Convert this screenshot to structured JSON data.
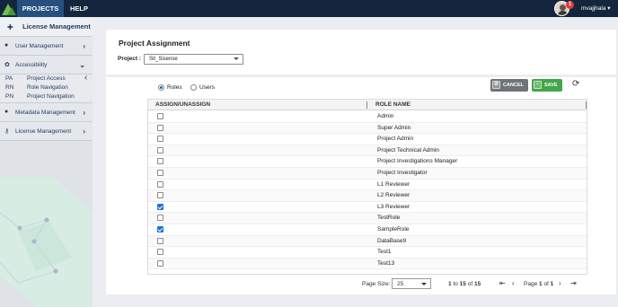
{
  "topbar": {
    "nav": [
      "PROJECTS",
      "HELP"
    ],
    "notification_count": "1",
    "username": "mvajjhala"
  },
  "sidebar": {
    "title": "License Management",
    "items": [
      {
        "label": "User Management"
      },
      {
        "label": "Accessibility"
      },
      {
        "label": "Metadata Management"
      },
      {
        "label": "License Management"
      }
    ],
    "subitems": [
      {
        "abbr": "PA",
        "label": "Project Access"
      },
      {
        "abbr": "RN",
        "label": "Role Navigation"
      },
      {
        "abbr": "PN",
        "label": "Project Navigation"
      }
    ]
  },
  "project_card": {
    "title": "Project Assignment",
    "project_label": "Project :",
    "project_value": "Sit_Sisense"
  },
  "toggle": {
    "options": [
      "Roles",
      "Users"
    ],
    "selected": "Roles"
  },
  "actions": {
    "cancel": "CANCEL",
    "save": "SAVE"
  },
  "grid": {
    "columns": [
      "ASSIGN/UNASSIGN",
      "ROLE NAME"
    ],
    "rows": [
      {
        "name": "Admin",
        "checked": false
      },
      {
        "name": "Super Admin",
        "checked": false
      },
      {
        "name": "Project Admin",
        "checked": false
      },
      {
        "name": "Project Technical Admin",
        "checked": false
      },
      {
        "name": "Project Investigations Manager",
        "checked": false
      },
      {
        "name": "Project Investigator",
        "checked": false
      },
      {
        "name": "L1 Reviewer",
        "checked": false
      },
      {
        "name": "L2 Reviewer",
        "checked": false
      },
      {
        "name": "L3 Reviewer",
        "checked": true
      },
      {
        "name": "TestRole",
        "checked": false
      },
      {
        "name": "SampleRole",
        "checked": true
      },
      {
        "name": "DataBase9",
        "checked": false
      },
      {
        "name": "Test1",
        "checked": false
      },
      {
        "name": "Test13",
        "checked": false
      }
    ]
  },
  "pager": {
    "page_size_label": "Page Size:",
    "page_size": "25",
    "from": "1",
    "to_label": "to",
    "to": "15",
    "of_label": "of",
    "total": "15",
    "page_label": "Page",
    "page": "1",
    "page_of_label": "of",
    "page_total": "1"
  },
  "colors": {
    "topbar": "#14263d",
    "accent": "#25507f",
    "save": "#43a64a",
    "cancel": "#6f7479",
    "checkbox": "#1e73d8"
  }
}
